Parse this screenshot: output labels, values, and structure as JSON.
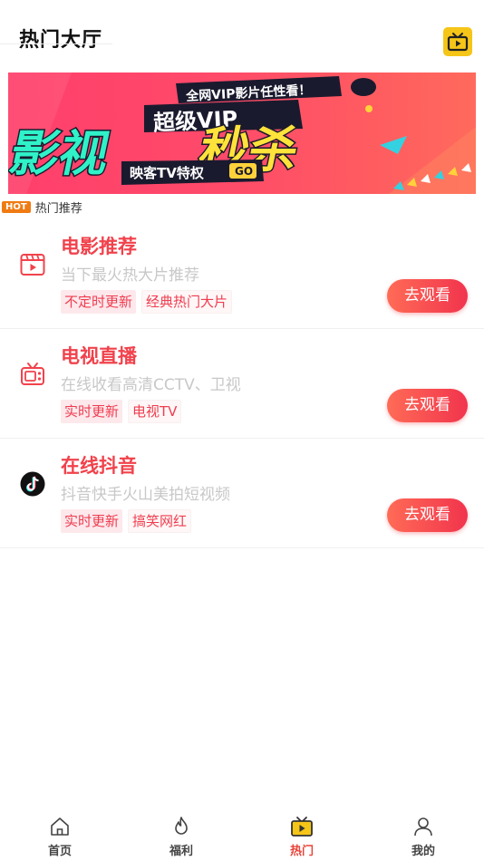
{
  "header": {
    "title": "热门大厅",
    "tv_icon": "tv-icon"
  },
  "banner": {
    "top_text": "全网VIP影片任性看！",
    "vip_text": "超级VIP",
    "main_text_1": "影视",
    "main_text_2": "秒杀",
    "sub_text": "映客TV特权",
    "go_text": "GO"
  },
  "section": {
    "badge": "HOT",
    "label": "热门推荐"
  },
  "cards": [
    {
      "title": "电影推荐",
      "desc": "当下最火热大片推荐",
      "tags": [
        "不定时更新",
        "经典热门大片"
      ],
      "button": "去观看",
      "icon": "film-icon"
    },
    {
      "title": "电视直播",
      "desc": "在线收看高清CCTV、卫视",
      "tags": [
        "实时更新",
        "电视TV"
      ],
      "button": "去观看",
      "icon": "retro-tv-icon"
    },
    {
      "title": "在线抖音",
      "desc": "抖音快手火山美拍短视频",
      "tags": [
        "实时更新",
        "搞笑网红"
      ],
      "button": "去观看",
      "icon": "tiktok-icon"
    }
  ],
  "tabbar": {
    "items": [
      {
        "label": "首页",
        "icon": "home-icon"
      },
      {
        "label": "福利",
        "icon": "flame-icon"
      },
      {
        "label": "热门",
        "icon": "tv-play-icon",
        "active": true
      },
      {
        "label": "我的",
        "icon": "user-icon"
      }
    ],
    "accent": "#e8443a"
  },
  "colors": {
    "accent": "#f1424c",
    "tag_text": "#ef3d4f",
    "header_icon_bg": "#f5c518"
  }
}
